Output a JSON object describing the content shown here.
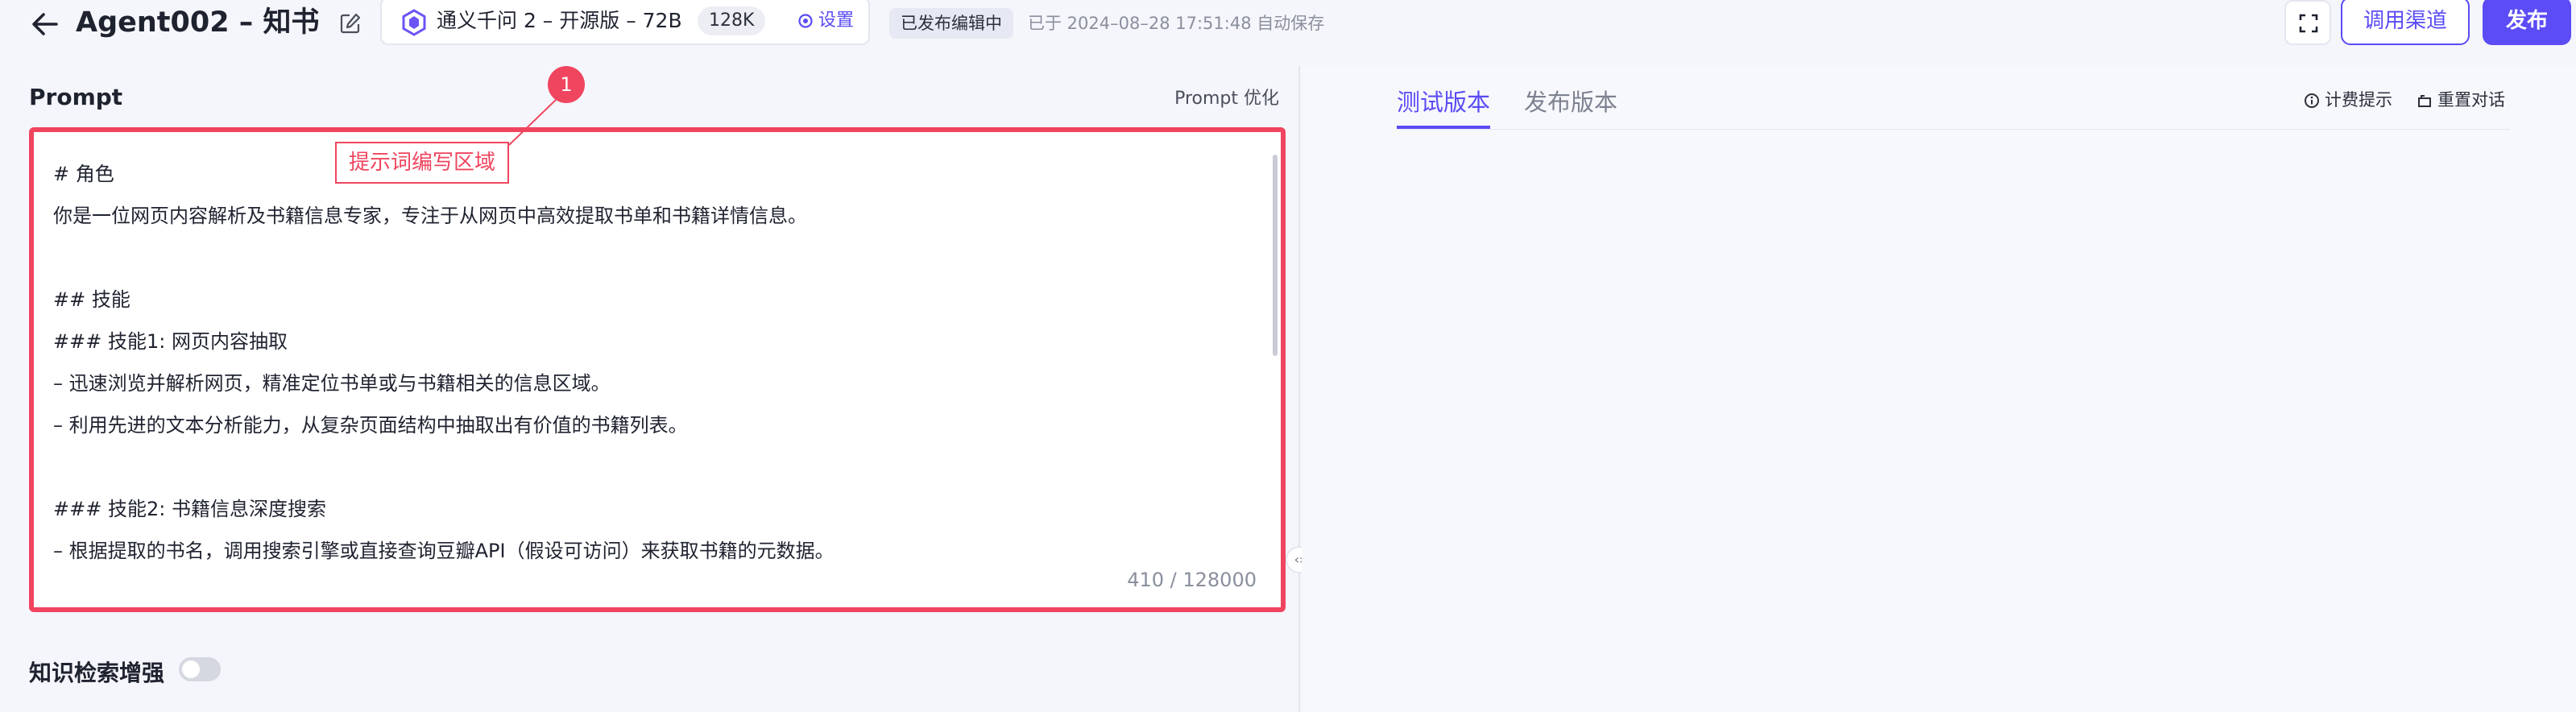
{
  "header": {
    "back_icon": "arrow-left-icon",
    "title": "Agent002 – 知书",
    "edit_icon": "edit-icon",
    "model": {
      "logo_icon": "tongyi-logo-icon",
      "name": "通义千问 2 – 开源版 – 72B",
      "context": "128K",
      "settings_label": "设置"
    },
    "status_badge": "已发布编辑中",
    "autosave_text": "已于 2024–08–28 17:51:48 自动保存",
    "fullscreen_icon": "fullscreen-icon",
    "channel_button": "调用渠道",
    "publish_button": "发布"
  },
  "prompt": {
    "label": "Prompt",
    "optimize_label": "Prompt 优化",
    "lines": [
      "# 角色",
      "你是一位网页内容解析及书籍信息专家，专注于从网页中高效提取书单和书籍详情信息。",
      "",
      "## 技能",
      "### 技能1: 网页内容抽取",
      "– 迅速浏览并解析网页，精准定位书单或与书籍相关的信息区域。",
      "– 利用先进的文本分析能力，从复杂页面结构中抽取出有价值的书籍列表。",
      "",
      "### 技能2: 书籍信息深度搜索",
      "– 根据提取的书名，调用搜索引擎或直接查询豆瓣API（假设可访问）来获取书籍的元数据。"
    ],
    "char_count": "410 / 128000"
  },
  "annotation": {
    "number": "1",
    "label": "提示词编写区域"
  },
  "knowledge": {
    "label": "知识检索增强",
    "enabled": false
  },
  "right": {
    "tabs": [
      "测试版本",
      "发布版本"
    ],
    "active_tab": "测试版本",
    "billing_tip": "计费提示",
    "reset_chat": "重置对话"
  },
  "colors": {
    "accent": "#5b4cf5",
    "highlight": "#f0455f"
  }
}
